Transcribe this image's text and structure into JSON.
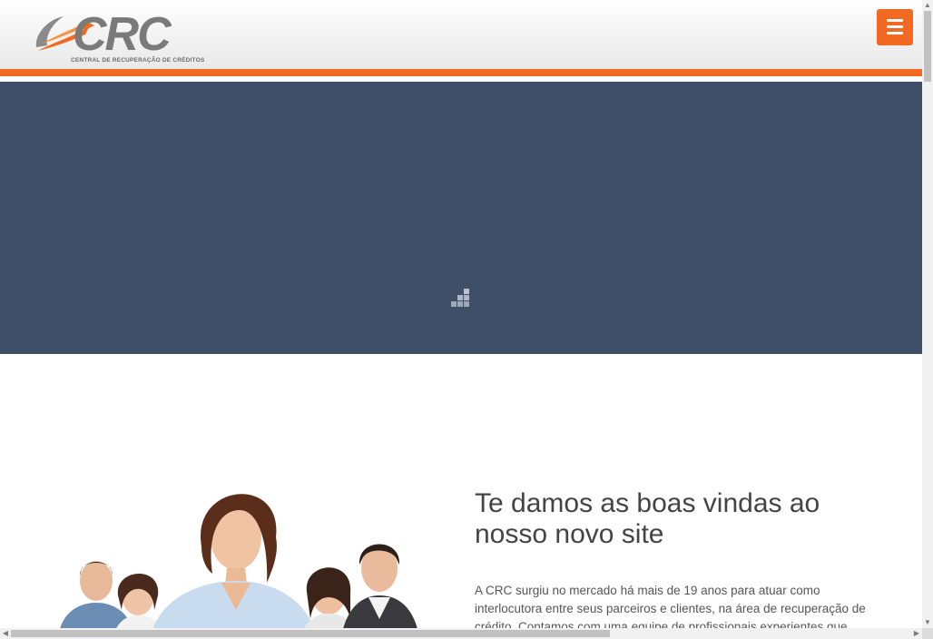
{
  "header": {
    "logo_text": "CRC",
    "logo_subtitle": "CENTRAL DE RECUPERAÇÃO DE CRÉDITOS",
    "menu_icon": "hamburger-icon",
    "accent_color": "#f26a21"
  },
  "hero": {
    "background_color": "#3e4f67",
    "loader_icon": "loading-grid-icon"
  },
  "welcome": {
    "title": "Te damos as boas vindas ao nosso novo site",
    "body": "A CRC surgiu no mercado há mais de 19 anos para atuar como interlocutora entre seus parceiros e clientes, na área de recuperação de crédito. Contamos com uma equipe de profissionais experientes que"
  },
  "scrollbars": {
    "up_arrow": "▲",
    "down_arrow": "▼",
    "left_arrow": "◀",
    "right_arrow": "▶"
  }
}
